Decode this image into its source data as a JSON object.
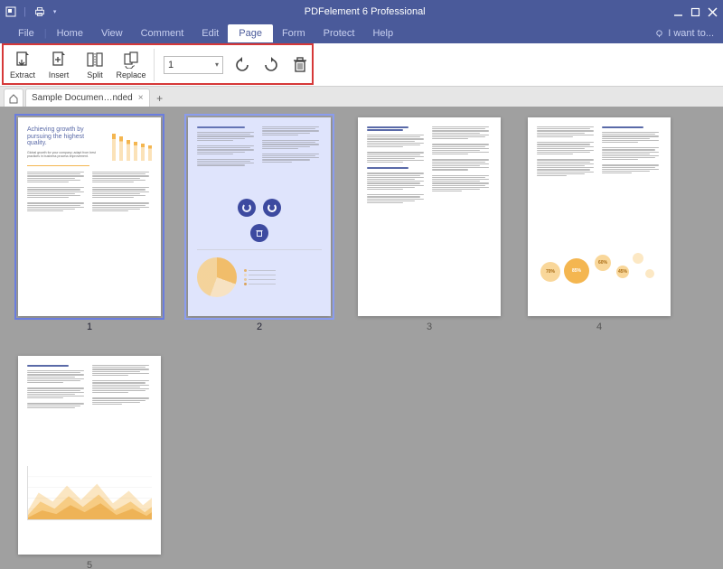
{
  "app": {
    "title": "PDFelement 6 Professional"
  },
  "menubar": {
    "items": [
      "File",
      "Home",
      "View",
      "Comment",
      "Edit",
      "Page",
      "Form",
      "Protect",
      "Help"
    ],
    "active_index": 5,
    "iwant": "I want to..."
  },
  "toolbar": {
    "buttons": [
      {
        "id": "extract",
        "label": "Extract"
      },
      {
        "id": "insert",
        "label": "Insert"
      },
      {
        "id": "split",
        "label": "Split"
      },
      {
        "id": "replace",
        "label": "Replace"
      }
    ],
    "page_value": "1",
    "icons": {
      "rotate_ccw": "rotate-ccw-icon",
      "rotate_cw": "rotate-cw-icon",
      "delete": "trash-icon"
    }
  },
  "tabs": {
    "document_label": "Sample Documen…nded",
    "close": "×",
    "plus": "+"
  },
  "thumbnails": {
    "items": [
      {
        "label": "1",
        "selected": "primary",
        "heading": "Achieving growth by pursuing the highest quality.",
        "subheading": "Global growth for your company; adapt from best practices in business process improvement."
      },
      {
        "label": "2",
        "selected": "secondary"
      },
      {
        "label": "3",
        "selected": ""
      },
      {
        "label": "4",
        "selected": "",
        "bubbles": [
          {
            "v": "70%"
          },
          {
            "v": "85%"
          },
          {
            "v": "60%"
          },
          {
            "v": "45%"
          }
        ]
      },
      {
        "label": "5",
        "selected": ""
      }
    ]
  },
  "colors": {
    "brand": "#4a5a9a",
    "accent": "#f4b650",
    "highlight": "#d63838",
    "selection": "#6a7de0"
  }
}
